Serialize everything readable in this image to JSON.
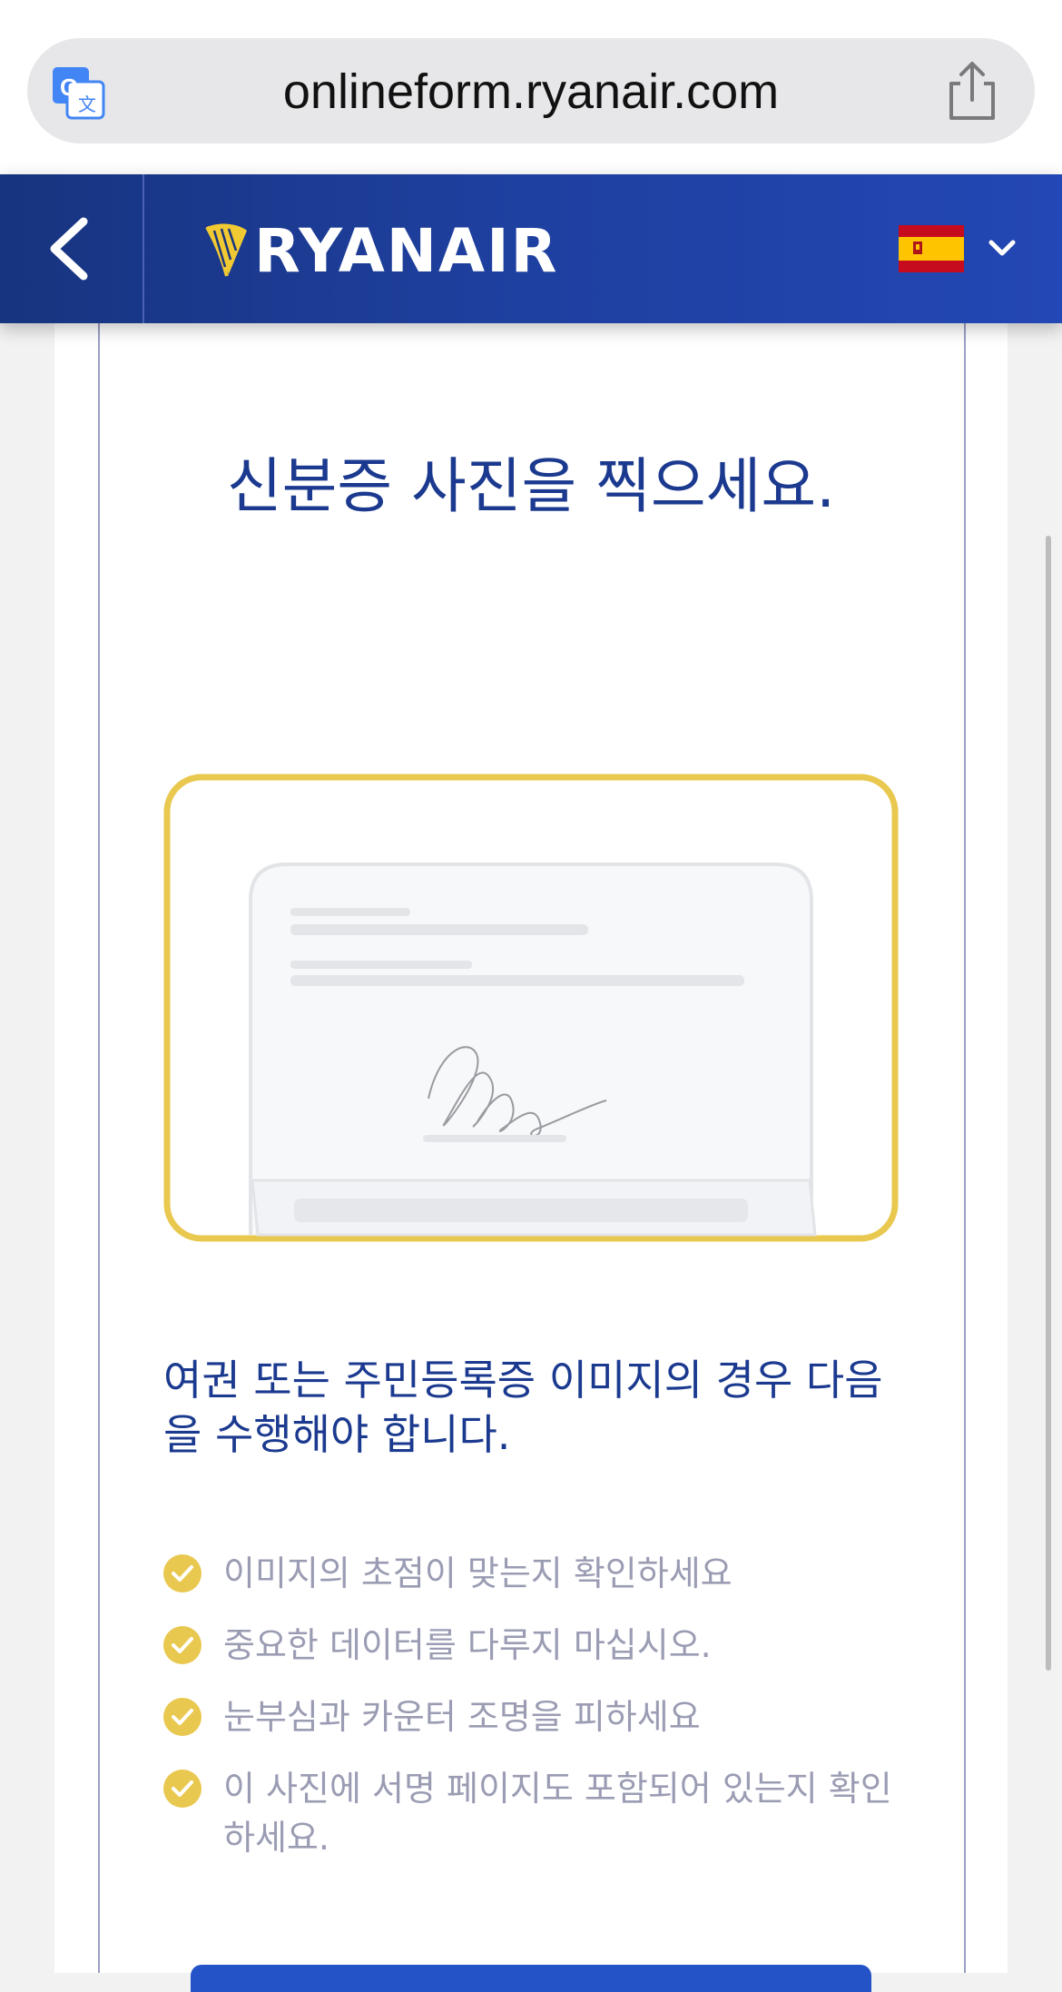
{
  "browser": {
    "url": "onlineform.ryanair.com",
    "translate_icon": "translate-icon",
    "share_icon": "share-icon"
  },
  "header": {
    "back_icon": "chevron-left-icon",
    "logo_text": "RYANAIR",
    "language_flag": "spain-flag",
    "language_chevron": "chevron-down-icon",
    "colors": {
      "header_blue": "#1e3f9e",
      "accent_yellow": "#e9c84f"
    }
  },
  "main": {
    "title": "신분증 사진을 찍으세요.",
    "instructions": "여권 또는 주민등록증 이미지의 경우 다음을 수행해야 합니다.",
    "checklist": [
      "이미지의 초점이 맞는지 확인하세요",
      "중요한 데이터를 다루지 마십시오.",
      "눈부심과 카운터 조명을 피하세요",
      "이 사진에 서명 페이지도 포함되어 있는지 확인하세요."
    ]
  }
}
